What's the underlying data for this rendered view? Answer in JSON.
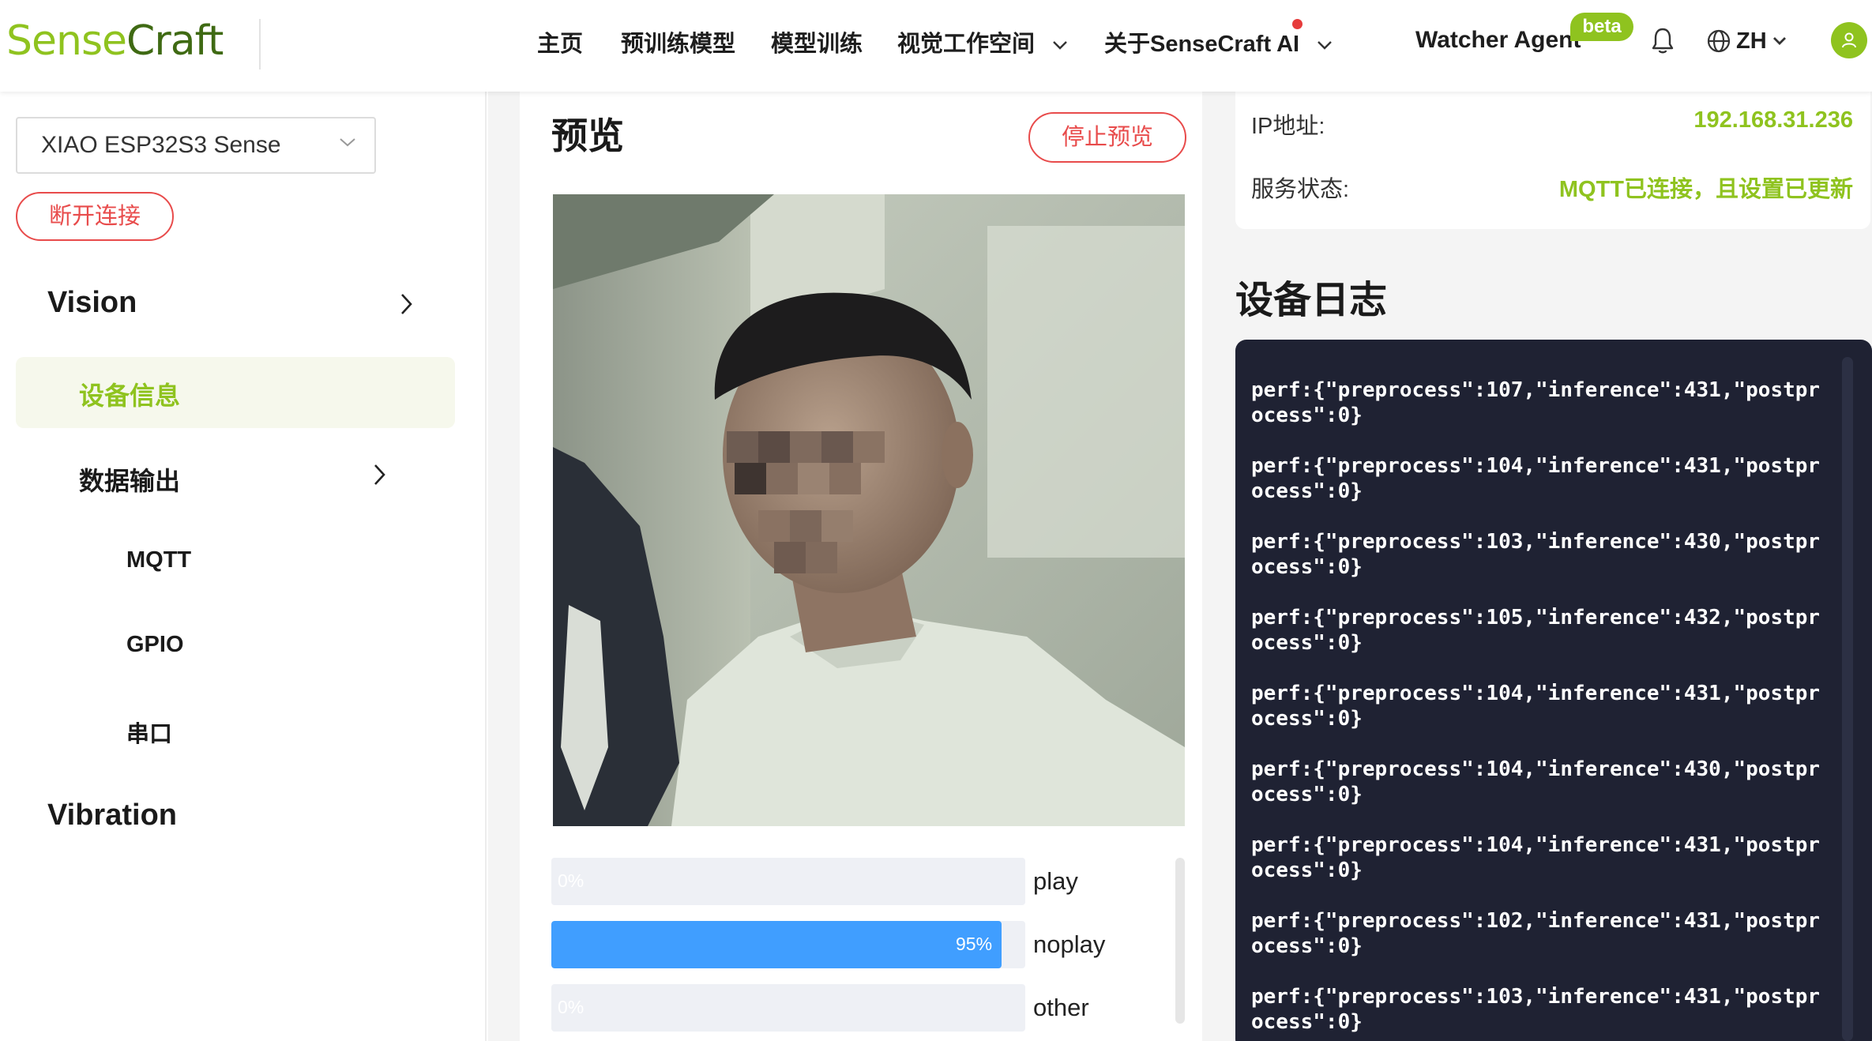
{
  "header": {
    "logo_part1": "Sense",
    "logo_part2": "Craft",
    "nav": [
      {
        "label": "主页"
      },
      {
        "label": "预训练模型"
      },
      {
        "label": "模型训练"
      },
      {
        "label": "视觉工作空间"
      },
      {
        "label": "关于SenseCraft AI"
      }
    ],
    "agent_label": "Watcher Agent",
    "beta_badge": "beta",
    "lang_label": "ZH",
    "accent_color": "#8fc31f"
  },
  "sidebar": {
    "device_select_value": "XIAO ESP32S3 Sense",
    "disconnect_label": "断开连接",
    "items": [
      {
        "label": "Vision"
      },
      {
        "label": "设备信息"
      },
      {
        "label": "数据输出"
      },
      {
        "label": "MQTT"
      },
      {
        "label": "GPIO"
      },
      {
        "label": "串口"
      },
      {
        "label": "Vibration"
      }
    ]
  },
  "preview": {
    "title": "预览",
    "stop_label": "停止预览",
    "classes": [
      {
        "label": "play",
        "percent": 0,
        "text": "0%"
      },
      {
        "label": "noplay",
        "percent": 95,
        "text": "95%"
      },
      {
        "label": "other",
        "percent": 0,
        "text": "0%"
      }
    ]
  },
  "info": {
    "ip_label": "IP地址:",
    "ip_value": "192.168.31.236",
    "status_label": "服务状态:",
    "status_value": "MQTT已连接，且设置已更新"
  },
  "log": {
    "title": "设备日志",
    "lines": [
      "perf:{\"preprocess\":107,\"inference\":431,\"postprocess\":0}",
      "perf:{\"preprocess\":104,\"inference\":431,\"postprocess\":0}",
      "perf:{\"preprocess\":103,\"inference\":430,\"postprocess\":0}",
      "perf:{\"preprocess\":105,\"inference\":432,\"postprocess\":0}",
      "perf:{\"preprocess\":104,\"inference\":431,\"postprocess\":0}",
      "perf:{\"preprocess\":104,\"inference\":430,\"postprocess\":0}",
      "perf:{\"preprocess\":104,\"inference\":431,\"postprocess\":0}",
      "perf:{\"preprocess\":102,\"inference\":431,\"postprocess\":0}",
      "perf:{\"preprocess\":103,\"inference\":431,\"postprocess\":0}"
    ]
  }
}
